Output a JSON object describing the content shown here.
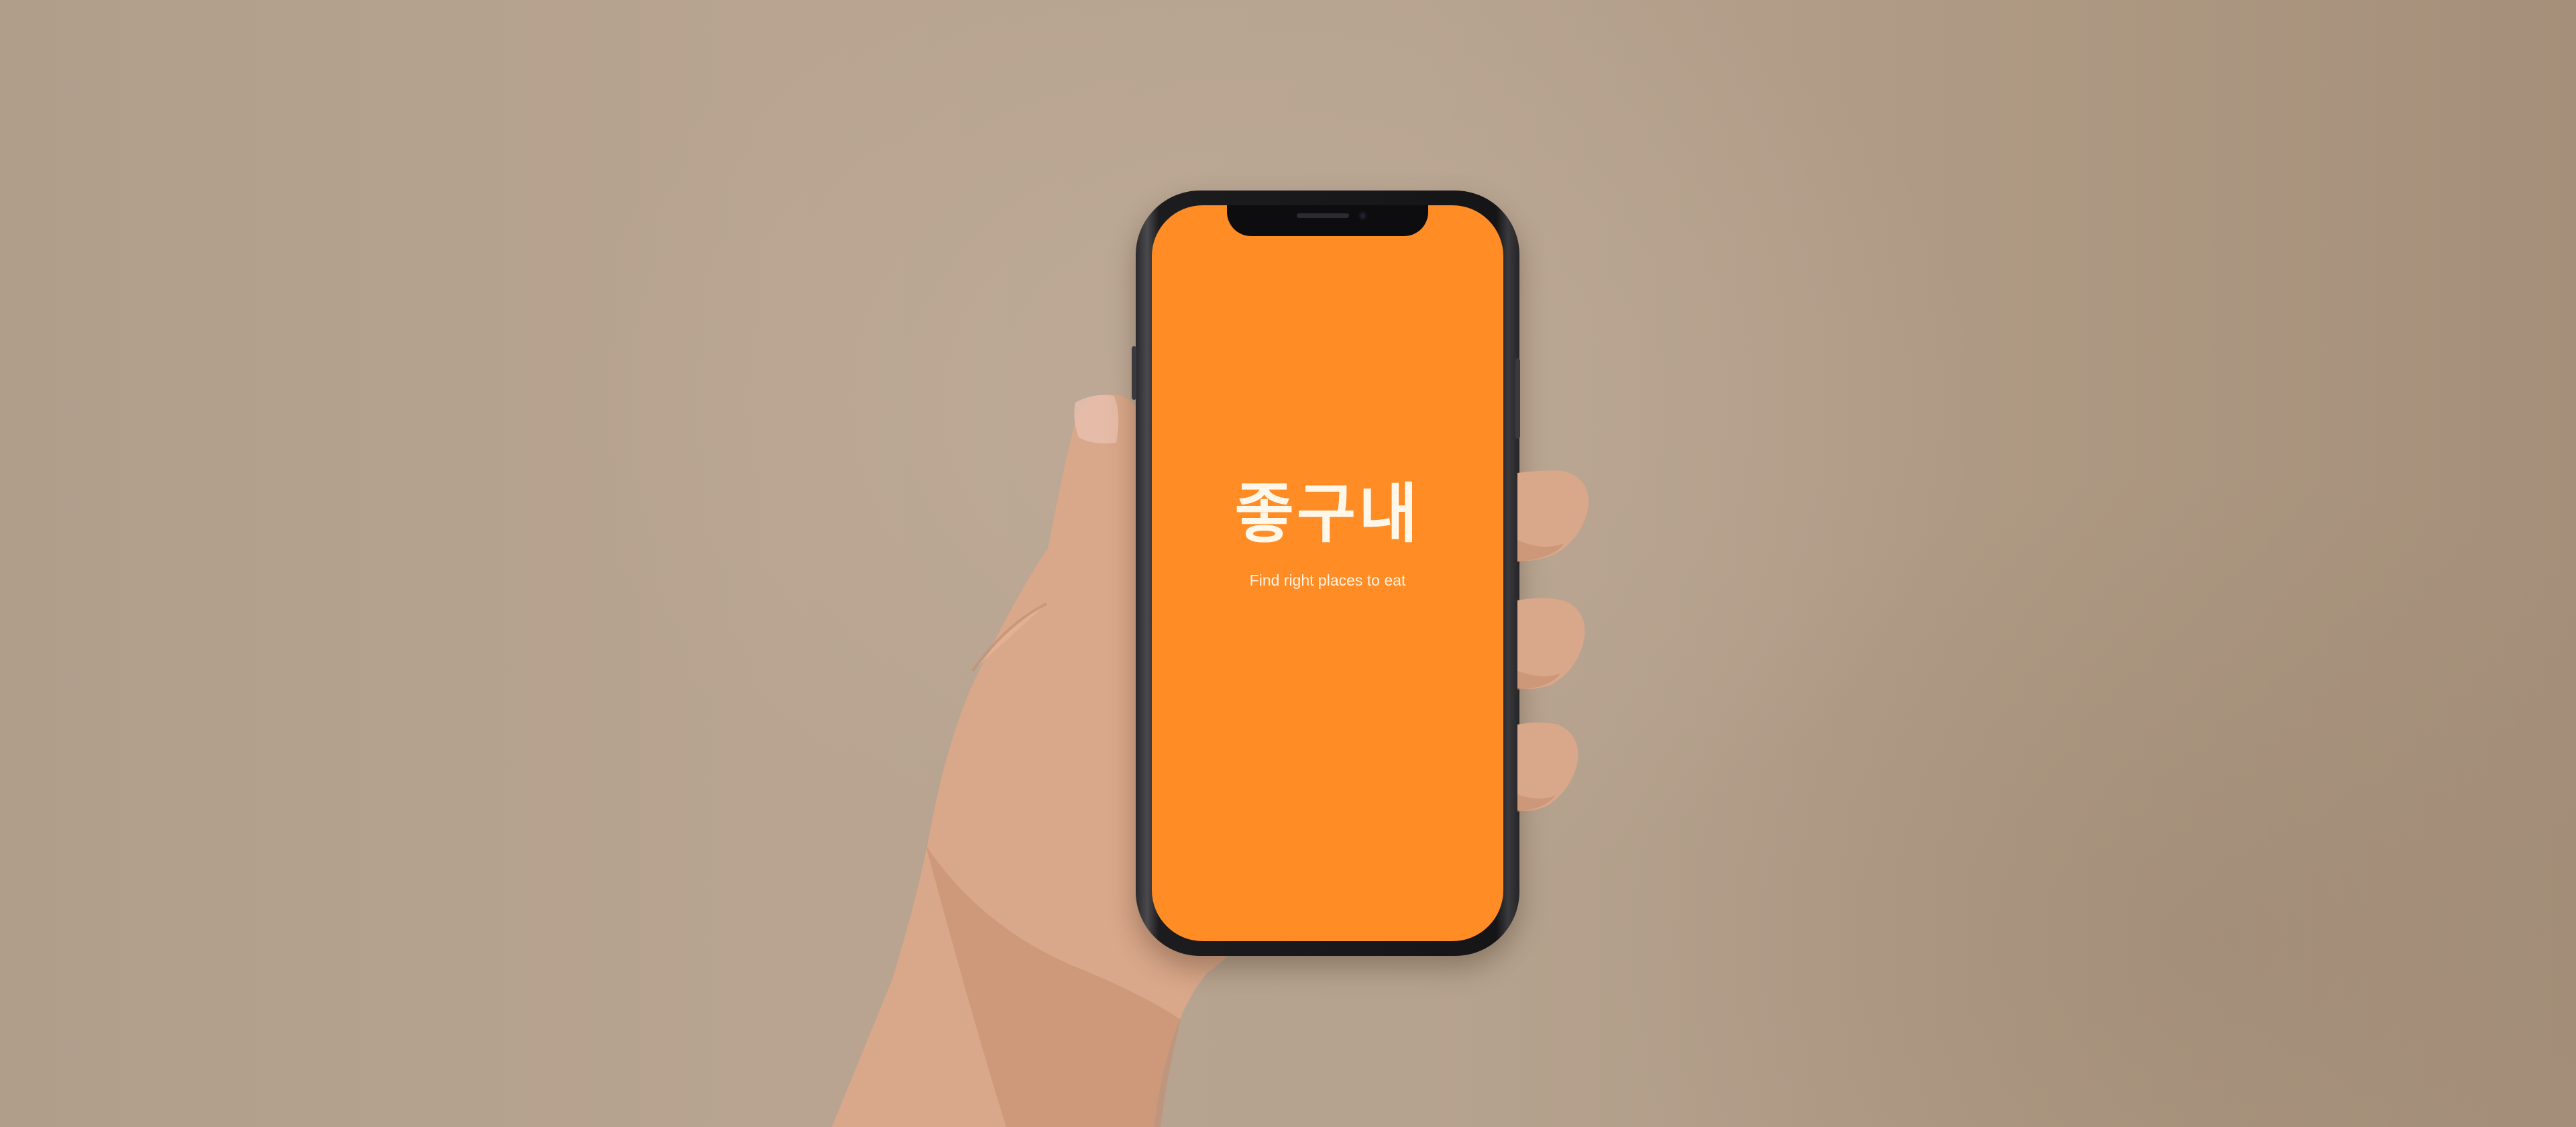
{
  "app": {
    "logo_text": "좋구내",
    "tagline": "Find right places to eat"
  },
  "colors": {
    "screen_background": "#ff8c24",
    "logo_text": "#fff7ea",
    "backdrop": "#b6a38f"
  }
}
